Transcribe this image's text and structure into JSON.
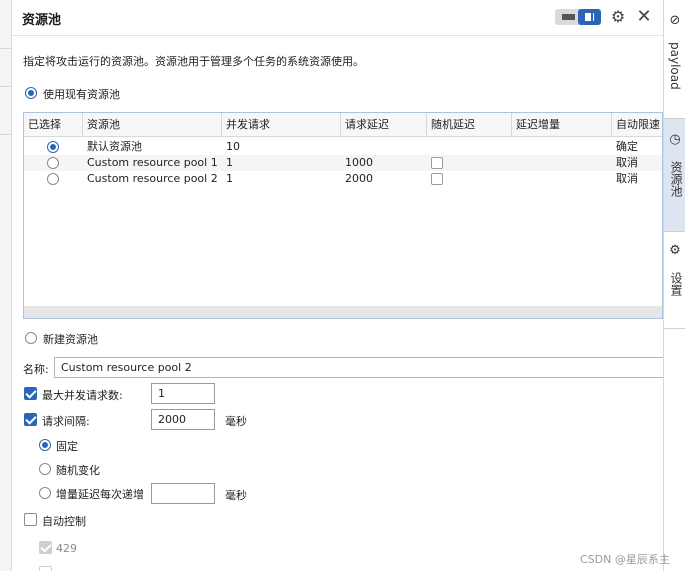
{
  "panel": {
    "title": "资源池",
    "description": "指定将攻击运行的资源池。资源池用于管理多个任务的系统资源使用。"
  },
  "use_existing": {
    "label": "使用现有资源池",
    "selected": true
  },
  "table": {
    "columns": [
      "已选择",
      "资源池",
      "并发请求",
      "请求延迟",
      "随机延迟",
      "延迟增量",
      "自动限速"
    ],
    "rows": [
      {
        "selected": true,
        "name": "默认资源池",
        "concurrent": "10",
        "delay": "",
        "random": false,
        "random_shown": false,
        "increment": "",
        "throttle": "确定"
      },
      {
        "selected": false,
        "name": "Custom resource pool 1",
        "concurrent": "1",
        "delay": "1000",
        "random": false,
        "random_shown": true,
        "increment": "",
        "throttle": "取消"
      },
      {
        "selected": false,
        "name": "Custom resource pool 2",
        "concurrent": "1",
        "delay": "2000",
        "random": false,
        "random_shown": true,
        "increment": "",
        "throttle": "取消"
      }
    ]
  },
  "create_new": {
    "label": "新建资源池",
    "selected": false
  },
  "name_field": {
    "label": "名称:",
    "value": "Custom resource pool 2"
  },
  "max_concurrent": {
    "label": "最大并发请求数:",
    "checked": true,
    "value": "1"
  },
  "request_interval": {
    "label": "请求间隔:",
    "checked": true,
    "value": "2000",
    "unit": "毫秒"
  },
  "interval_mode": {
    "fixed": {
      "label": "固定",
      "selected": true
    },
    "random": {
      "label": "随机变化",
      "selected": false
    },
    "increment": {
      "label": "增量延迟每次递增",
      "selected": false,
      "value": "",
      "unit": "毫秒"
    }
  },
  "auto_control": {
    "label": "自动控制",
    "checked": false
  },
  "status_429": {
    "label": "429",
    "checked": true,
    "disabled": true
  },
  "sidebar": {
    "tabs": [
      {
        "label": "payload",
        "icon": "payload-icon"
      },
      {
        "label": "资源池",
        "icon": "clock-icon",
        "active": true
      },
      {
        "label": "设置",
        "icon": "gear-icon"
      }
    ]
  },
  "watermark": "CSDN @星辰系主",
  "colors": {
    "accent": "#2b66b6",
    "active_tab": "#dde5f1"
  }
}
